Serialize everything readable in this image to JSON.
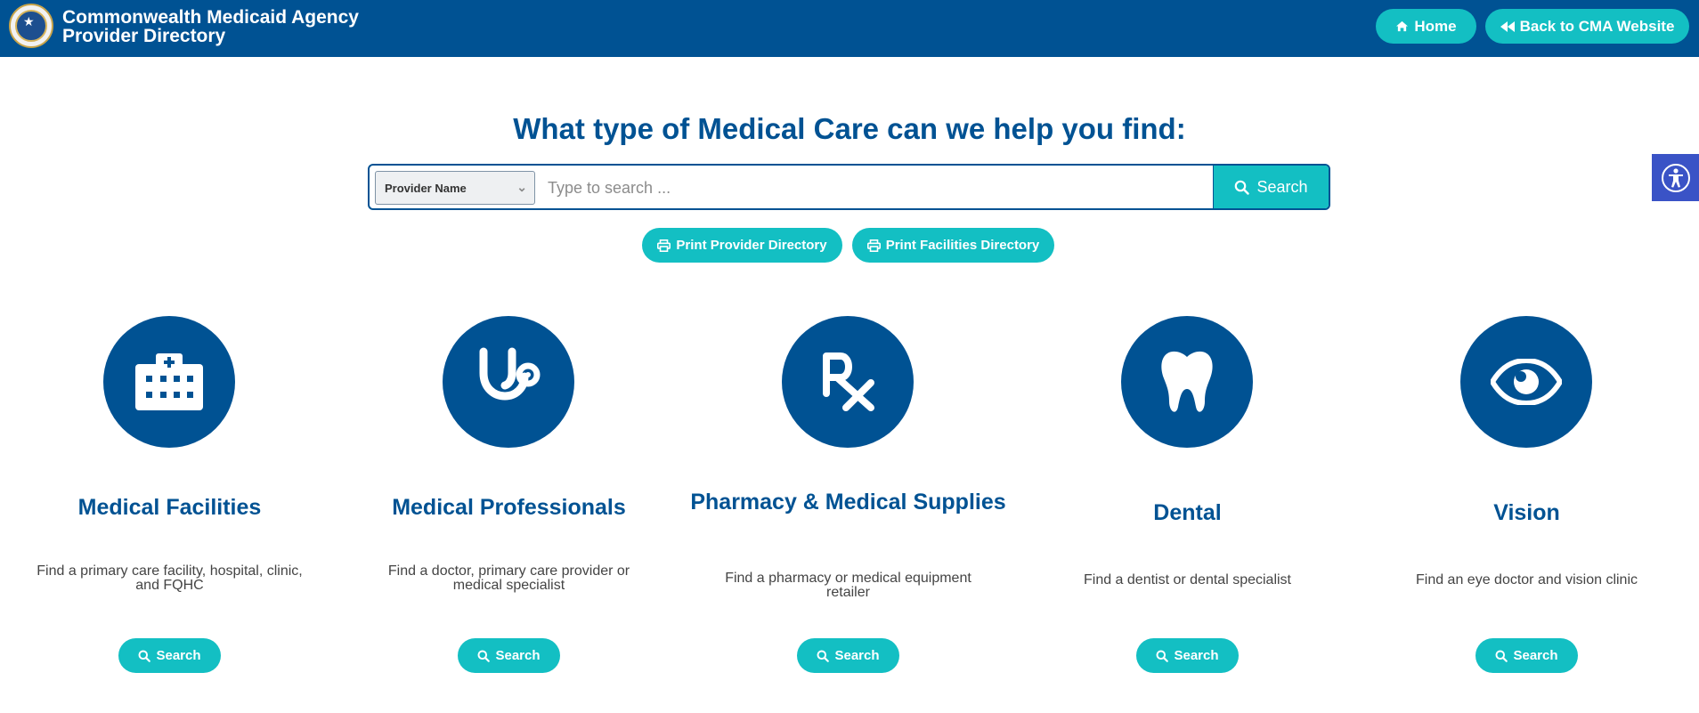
{
  "header": {
    "title_line1": "Commonwealth Medicaid Agency",
    "title_line2": "Provider Directory",
    "home_label": "Home",
    "back_label": "Back to CMA Website"
  },
  "hero": {
    "title": "What type of Medical Care can we help you find:"
  },
  "search": {
    "select_value": "Provider Name",
    "placeholder": "Type to search ...",
    "button_label": "Search"
  },
  "print": {
    "provider_label": "Print Provider Directory",
    "facilities_label": "Print Facilities Directory"
  },
  "cards": [
    {
      "title": "Medical Facilities",
      "desc": "Find a primary care facility, hospital, clinic, and FQHC",
      "button": "Search",
      "icon": "hospital-icon"
    },
    {
      "title": "Medical Professionals",
      "desc": "Find a doctor, primary care provider or medical specialist",
      "button": "Search",
      "icon": "stethoscope-icon"
    },
    {
      "title": "Pharmacy & Medical Supplies",
      "desc": "Find a pharmacy or medical equipment retailer",
      "button": "Search",
      "icon": "prescription-icon"
    },
    {
      "title": "Dental",
      "desc": "Find a dentist or dental specialist",
      "button": "Search",
      "icon": "tooth-icon"
    },
    {
      "title": "Vision",
      "desc": "Find an eye doctor and vision clinic",
      "button": "Search",
      "icon": "eye-icon"
    }
  ],
  "colors": {
    "brand_blue": "#005293",
    "accent_teal": "#13bfc3",
    "accessibility_blue": "#3a53c6"
  }
}
